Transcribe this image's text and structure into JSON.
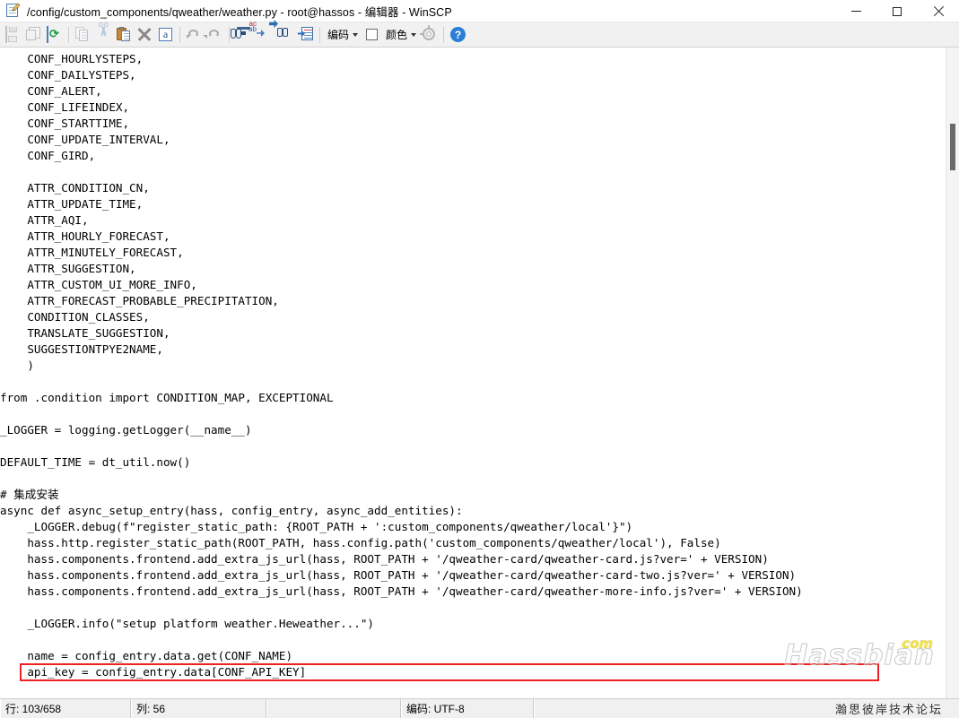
{
  "window": {
    "title": "/config/custom_components/qweather/weather.py - root@hassos - 编辑器 - WinSCP",
    "app_icon": "edit-document-icon",
    "controls": {
      "minimize": "minimize-icon",
      "maximize": "maximize-icon",
      "close": "close-icon"
    }
  },
  "toolbar": {
    "buttons": [
      {
        "name": "save-icon",
        "tooltip": "保存",
        "enabled": false
      },
      {
        "name": "save-all-icon",
        "tooltip": "全部保存",
        "enabled": false
      },
      {
        "name": "reload-icon",
        "tooltip": "重新载入",
        "enabled": true
      },
      {
        "name": "copy-icon",
        "tooltip": "复制",
        "enabled": false
      },
      {
        "name": "cut-icon",
        "tooltip": "剪切",
        "enabled": false
      },
      {
        "name": "paste-icon",
        "tooltip": "粘贴",
        "enabled": true
      },
      {
        "name": "delete-icon",
        "tooltip": "删除",
        "enabled": true
      },
      {
        "name": "select-all-icon",
        "tooltip": "全选",
        "enabled": true,
        "glyph": "a"
      },
      {
        "name": "undo-icon",
        "tooltip": "撤消",
        "enabled": false
      },
      {
        "name": "redo-icon",
        "tooltip": "重做",
        "enabled": false
      },
      {
        "name": "find-icon",
        "tooltip": "查找",
        "enabled": true
      },
      {
        "name": "replace-icon",
        "tooltip": "替换",
        "enabled": true
      },
      {
        "name": "find-next-icon",
        "tooltip": "查找下一个",
        "enabled": true
      },
      {
        "name": "goto-line-icon",
        "tooltip": "转到行",
        "enabled": true
      }
    ],
    "encoding_dropdown": {
      "label": "编码",
      "caret": "chevron-down-icon"
    },
    "color_swatch": "#ffffff",
    "color_dropdown": {
      "label": "颜色",
      "caret": "chevron-down-icon"
    },
    "preferences": "gear-icon",
    "help": {
      "name": "help-icon",
      "glyph": "?"
    }
  },
  "editor": {
    "highlight": {
      "color": "#ee2222",
      "line_index": 38
    },
    "lines": [
      "    CONF_HOURLYSTEPS,",
      "    CONF_DAILYSTEPS,",
      "    CONF_ALERT,",
      "    CONF_LIFEINDEX,",
      "    CONF_STARTTIME,",
      "    CONF_UPDATE_INTERVAL,",
      "    CONF_GIRD,",
      "",
      "    ATTR_CONDITION_CN,",
      "    ATTR_UPDATE_TIME,",
      "    ATTR_AQI,",
      "    ATTR_HOURLY_FORECAST,",
      "    ATTR_MINUTELY_FORECAST,",
      "    ATTR_SUGGESTION,",
      "    ATTR_CUSTOM_UI_MORE_INFO,",
      "    ATTR_FORECAST_PROBABLE_PRECIPITATION,",
      "    CONDITION_CLASSES,",
      "    TRANSLATE_SUGGESTION,",
      "    SUGGESTIONTPYE2NAME,",
      "    )",
      "",
      "from .condition import CONDITION_MAP, EXCEPTIONAL",
      "",
      "_LOGGER = logging.getLogger(__name__)",
      "",
      "DEFAULT_TIME = dt_util.now()",
      "",
      "# 集成安装",
      "async def async_setup_entry(hass, config_entry, async_add_entities):",
      "    _LOGGER.debug(f\"register_static_path: {ROOT_PATH + ':custom_components/qweather/local'}\")",
      "    hass.http.register_static_path(ROOT_PATH, hass.config.path('custom_components/qweather/local'), False)",
      "    hass.components.frontend.add_extra_js_url(hass, ROOT_PATH + '/qweather-card/qweather-card.js?ver=' + VERSION)",
      "    hass.components.frontend.add_extra_js_url(hass, ROOT_PATH + '/qweather-card/qweather-card-two.js?ver=' + VERSION)",
      "    hass.components.frontend.add_extra_js_url(hass, ROOT_PATH + '/qweather-card/qweather-more-info.js?ver=' + VERSION)",
      "",
      "    _LOGGER.info(\"setup platform weather.Heweather...\")",
      "",
      "    name = config_entry.data.get(CONF_NAME)",
      "    api_key = config_entry.data[CONF_API_KEY]"
    ]
  },
  "scrollbar": {
    "name": "vertical-scrollbar",
    "thumb": "scrollbar-thumb"
  },
  "watermark": {
    "brand": "Hassbian",
    "tld": "com",
    "tld_color": "#f5e642"
  },
  "statusbar": {
    "line": "行: 103/658",
    "column": "列: 56",
    "middle": "",
    "encoding": "编码: UTF-8",
    "forum": "瀚思彼岸技术论坛"
  }
}
